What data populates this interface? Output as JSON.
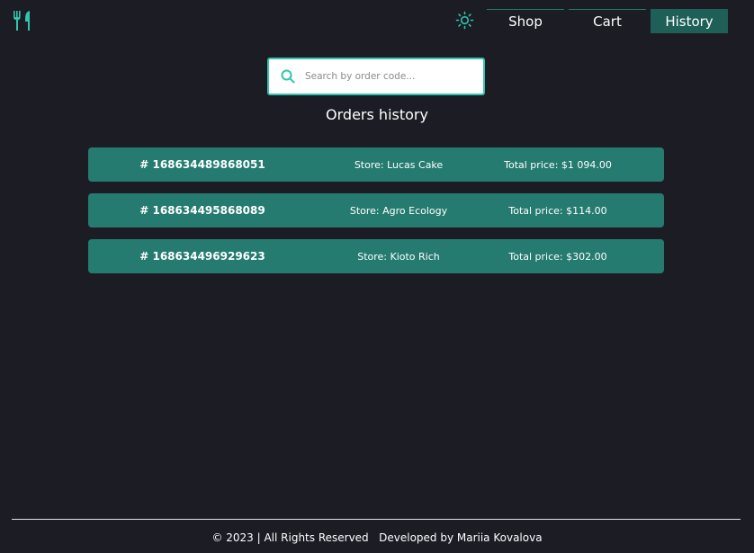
{
  "colors": {
    "background": "#1b1c24",
    "accent": "#33c3ae",
    "row_bg": "#257b70",
    "active_nav": "#1e5f57"
  },
  "header": {
    "logo_icon": "fork-knife-icon",
    "theme_icon": "sun-icon",
    "nav": {
      "shop": "Shop",
      "cart": "Cart",
      "history": "History",
      "active": "History"
    }
  },
  "search": {
    "icon": "search-icon",
    "placeholder": "Search by order code...",
    "value": ""
  },
  "main": {
    "title": "Orders history",
    "orders": [
      {
        "code": "# 168634489868051",
        "store": "Store: Lucas Cake",
        "total": "Total price: $1 094.00"
      },
      {
        "code": "# 168634495868089",
        "store": "Store: Agro Ecology",
        "total": "Total price: $114.00"
      },
      {
        "code": "# 168634496929623",
        "store": "Store: Kioto Rich",
        "total": "Total price: $302.00"
      }
    ]
  },
  "footer": {
    "copyright": "© 2023 | All Rights Reserved",
    "developer": "Developed by Mariia Kovalova"
  }
}
